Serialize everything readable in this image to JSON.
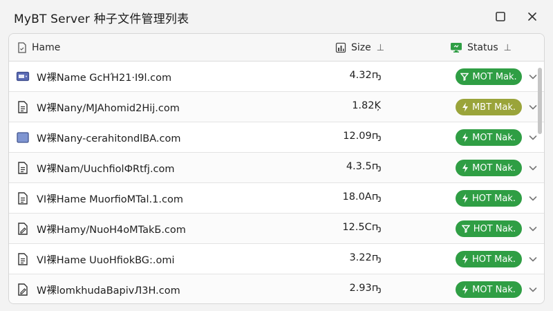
{
  "window": {
    "title": "MyBT  Server 种子文件管理列表"
  },
  "header": {
    "name": "Hame",
    "size": "Size",
    "status": "Status",
    "sort_glyph": "⊥"
  },
  "colors": {
    "green": "#2f9e44",
    "olive": "#9aa43a"
  },
  "rows": [
    {
      "icon": "server-icon",
      "name": "W裸Name GcHΉ21·I9l.com",
      "size": "4.32ҧ",
      "status": "MOT Mak.",
      "status_icon": "filter-icon",
      "color": "#2f9e44"
    },
    {
      "icon": "document-icon",
      "name": "W裸Nany/MJAhomid2Hij.com",
      "size": "1.82Ķ",
      "status": "MBT Mak.",
      "status_icon": "bolt-icon",
      "color": "#9aa43a"
    },
    {
      "icon": "folder-icon",
      "name": "W裸Nany-cerahitondlBA.com",
      "size": "12.09ҧ",
      "status": "MOT Nak.",
      "status_icon": "bolt-icon",
      "color": "#2f9e44"
    },
    {
      "icon": "document-icon",
      "name": "W裸Nam/UuchfiolФRtfj.com",
      "size": "4.3.5ҧ",
      "status": "MOT Nak.",
      "status_icon": "bolt-icon",
      "color": "#2f9e44"
    },
    {
      "icon": "document-icon",
      "name": "VI裸Hame MuorfioMTal.1.com",
      "size": "18.0Aҧ",
      "status": "HOT Mak.",
      "status_icon": "bolt-icon",
      "color": "#2f9e44"
    },
    {
      "icon": "edit-icon",
      "name": "W裸Hamy/NuoH4oMTakБ.com",
      "size": "12.5Cҧ",
      "status": "HOT Nak.",
      "status_icon": "filter-icon",
      "color": "#2f9e44"
    },
    {
      "icon": "document-icon",
      "name": "VI裸Hame UuoHfiokBG:.omi",
      "size": "3.22ҧ",
      "status": "HOT Mak.",
      "status_icon": "bolt-icon",
      "color": "#2f9e44"
    },
    {
      "icon": "edit-icon",
      "name": "W裸lomkhudаBapivЛ3H.com",
      "size": "2.93ҧ",
      "status": "MOT Nak.",
      "status_icon": "bolt-icon",
      "color": "#2f9e44"
    }
  ]
}
